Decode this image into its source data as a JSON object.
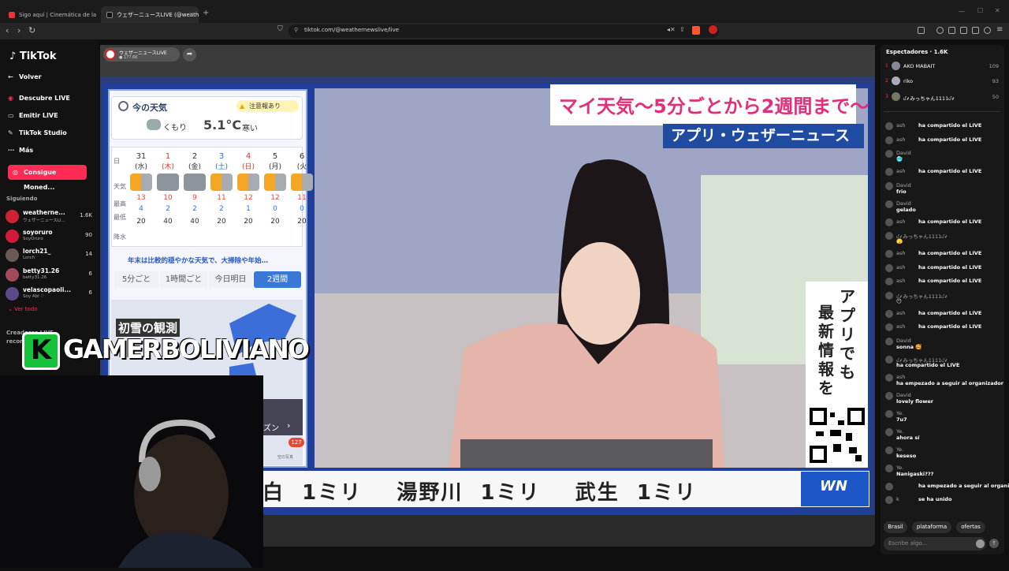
{
  "browser": {
    "tabs": [
      {
        "title": "Sigo aquí | Cinemática de la tempor..."
      },
      {
        "title": "ウェザーニュースLIVE (@weathe..."
      }
    ],
    "new_tab": "+",
    "url": "tiktok.com/@weathernewslive/live"
  },
  "sidebar": {
    "brand": "TikTok",
    "nav": [
      {
        "label": "Volver",
        "icon": "back-arrow-icon"
      },
      {
        "label": "Descubre LIVE",
        "icon": "live-icon"
      },
      {
        "label": "Emitir LIVE",
        "icon": "broadcast-icon"
      },
      {
        "label": "TikTok Studio",
        "icon": "studio-icon"
      },
      {
        "label": "Más",
        "icon": "more-icon"
      }
    ],
    "coins_button": "Consigue Moned...",
    "following_title": "Siguiendo",
    "following": [
      {
        "name": "weatherne...",
        "sub": "ウェザーニュースLI...",
        "count": "1.6K"
      },
      {
        "name": "soyoruro",
        "sub": "SoyOruro",
        "count": "90"
      },
      {
        "name": "lorch21_",
        "sub": "Lorch",
        "count": "14"
      },
      {
        "name": "betty31.26",
        "sub": "betty31.26",
        "count": "6"
      },
      {
        "name": "velascopaoli...",
        "sub": "Soy Abi ♡",
        "count": "6"
      }
    ],
    "see_all": "Ver todo",
    "creators_title": "Creadores LIVE recomendados"
  },
  "stream": {
    "channel_name": "ウェザーニュースLIVE",
    "views": "177.6K",
    "weather": {
      "now_title": "今の天気",
      "alert": "注意報あり",
      "condition": "くもり",
      "temp": "5.1°C",
      "feel": "寒い",
      "row_labels": {
        "day": "日",
        "weather": "天気",
        "high": "最高",
        "low": "最低",
        "precip": "降水"
      },
      "days": [
        {
          "date": "31",
          "dow": "(水)",
          "high": "13",
          "low": "4",
          "precip": "20",
          "color": "#333333",
          "icon": "sun-cloud"
        },
        {
          "date": "1",
          "dow": "(木)",
          "high": "10",
          "low": "2",
          "precip": "40",
          "color": "#d93a2b",
          "icon": "cloud"
        },
        {
          "date": "2",
          "dow": "(金)",
          "high": "9",
          "low": "2",
          "precip": "40",
          "color": "#333333",
          "icon": "cloud"
        },
        {
          "date": "3",
          "dow": "(土)",
          "high": "11",
          "low": "2",
          "precip": "20",
          "color": "#2a6fd6",
          "icon": "sun-cloud"
        },
        {
          "date": "4",
          "dow": "(日)",
          "high": "12",
          "low": "1",
          "precip": "20",
          "color": "#d93a2b",
          "icon": "sun-cloud"
        },
        {
          "date": "5",
          "dow": "(月)",
          "high": "12",
          "low": "0",
          "precip": "20",
          "color": "#333333",
          "icon": "sun-cloud"
        },
        {
          "date": "6",
          "dow": "(火",
          "high": "11",
          "low": "0",
          "precip": "20",
          "color": "#333333",
          "icon": "sun-cloud"
        }
      ],
      "link": "年末は比較的穏やかな天気で、大掃除や年始…",
      "segments": [
        "5分ごと",
        "1時間ごと",
        "今日明日",
        "2週間"
      ],
      "snow_title": "初雪の観測",
      "snow_tag": "ズン",
      "snow_badge": "127",
      "snow_caption": "空の写真"
    },
    "headline": "マイ天気～5分ごとから2週間まで～",
    "subheadline": "アプリ・ウェザーニュース",
    "promo": [
      "アプリでも",
      "最新情報を"
    ],
    "ticker": "白  1ミリ    湯野川  1ミリ    武生  1ミリ",
    "wn_logo": "WN",
    "overlay_name": "GAMERBOLIVIANO",
    "overlay_logo": "K"
  },
  "chat": {
    "viewers_title": "Espectadores · 1.6K",
    "top_viewers": [
      {
        "rank": "1",
        "name": "AKO MABAIT",
        "score": "109"
      },
      {
        "rank": "2",
        "name": "riko",
        "score": "93"
      },
      {
        "rank": "3",
        "name": "ᦔ⸙みっちゃん1111ᦔ⸙",
        "score": "50"
      }
    ],
    "messages": [
      {
        "user": "ash",
        "text": "ha compartido el LIVE",
        "inline": true
      },
      {
        "user": "ash",
        "text": "ha compartido el LIVE",
        "inline": true
      },
      {
        "user": "David",
        "text": "🥶",
        "inline": false
      },
      {
        "user": "ash",
        "text": "ha compartido el LIVE",
        "inline": true
      },
      {
        "user": "David",
        "text": "frio",
        "inline": false
      },
      {
        "user": "David",
        "text": "gelado",
        "inline": false
      },
      {
        "user": "ash",
        "text": "ha compartido el LIVE",
        "inline": true
      },
      {
        "user": "ᦔ⸙みっちゃん1111ᦔ⸙",
        "text": "🫣",
        "inline": false
      },
      {
        "user": "ash",
        "text": "ha compartido el LIVE",
        "inline": true
      },
      {
        "user": "ash",
        "text": "ha compartido el LIVE",
        "inline": true
      },
      {
        "user": "ash",
        "text": "ha compartido el LIVE",
        "inline": true
      },
      {
        "user": "ᦔ⸙みっちゃん1111ᦔ⸙",
        "text": "😶",
        "inline": false
      },
      {
        "user": "ash",
        "text": "ha compartido el LIVE",
        "inline": true
      },
      {
        "user": "ash",
        "text": "ha compartido el LIVE",
        "inline": true
      },
      {
        "user": "David",
        "text": "sonna 🥰",
        "inline": false
      },
      {
        "user": "ᦔ⸙みっちゃん1111ᦔ⸙",
        "text": "ha compartido el LIVE",
        "inline": false
      },
      {
        "user": "ash",
        "text": "ha empezado a seguir al organizador",
        "inline": false
      },
      {
        "user": "David",
        "text": "lovely flower",
        "inline": false
      },
      {
        "user": "Ye.",
        "text": "7u7",
        "inline": false
      },
      {
        "user": "Ye.",
        "text": "ahora sí",
        "inline": false
      },
      {
        "user": "Ye.",
        "text": "keseso",
        "inline": false
      },
      {
        "user": "Ye.",
        "text": "Nanigaski???",
        "inline": false
      },
      {
        "user": "",
        "text": "ha empezado a seguir al organizador",
        "inline": true
      },
      {
        "user": "k",
        "text": "se ha unido",
        "inline": true
      }
    ],
    "chips": [
      "Brasil",
      "plataforma",
      "ofertas"
    ],
    "input_placeholder": "Escribe algo...",
    "colors": {
      "accent": "#fe2c55",
      "chat_bg": "#181818"
    }
  }
}
